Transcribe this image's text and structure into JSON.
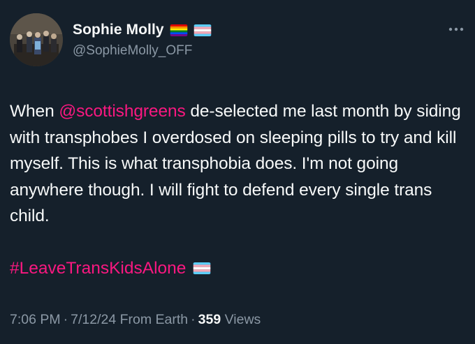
{
  "tweet": {
    "display_name": "Sophie Molly",
    "handle": "@SophieMolly_OFF",
    "badges": [
      "rainbow-flag-icon",
      "trans-flag-icon"
    ],
    "text": {
      "part1": "When ",
      "mention": "@scottishgreens",
      "part2": " de-selected me last month by siding with transphobes I overdosed on sleeping pills to try and kill myself. This is what transphobia does. I'm not going anywhere though. I will fight to defend every single trans child."
    },
    "hashtag": "#LeaveTransKidsAlone",
    "hashtag_emoji": "trans-flag-icon",
    "time": "7:06 PM",
    "date": "7/12/24",
    "source": "From Earth",
    "views_count": "359",
    "views_label": "Views",
    "separator": "·"
  },
  "colors": {
    "background": "#15202b",
    "primary_text": "#f7f9f9",
    "secondary_text": "#8b98a5",
    "link": "#f91880"
  }
}
